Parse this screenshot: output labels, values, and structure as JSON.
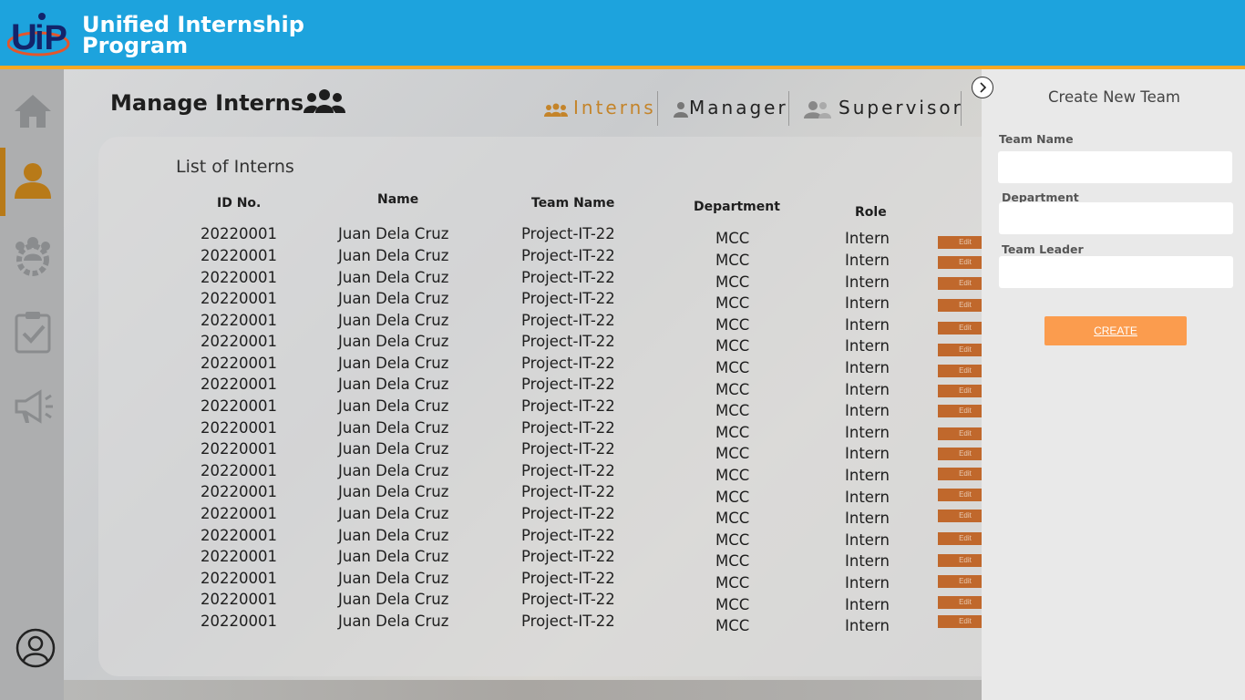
{
  "header": {
    "brand_line1": "Unified Internship",
    "brand_line2": "Program",
    "logo_text": "UiP"
  },
  "sidebar": {
    "items": [
      {
        "icon": "home-icon"
      },
      {
        "icon": "user-icon",
        "active": true
      },
      {
        "icon": "team-gear-icon"
      },
      {
        "icon": "clipboard-check-icon"
      },
      {
        "icon": "megaphone-icon"
      }
    ],
    "profile_icon": "profile-icon"
  },
  "page": {
    "title": "Manage Interns",
    "tabs": [
      {
        "label": "Interns",
        "active": true
      },
      {
        "label": "Manager"
      },
      {
        "label": "Supervisor"
      }
    ]
  },
  "list": {
    "title": "List of Interns",
    "columns": [
      "ID No.",
      "Name",
      "Team Name",
      "Department",
      "Role"
    ],
    "edit_label": "Edit",
    "rows": [
      {
        "id": "20220001",
        "name": "Juan Dela Cruz",
        "team": "Project-IT-22",
        "dept": "MCC",
        "role": "Intern"
      },
      {
        "id": "20220001",
        "name": "Juan Dela Cruz",
        "team": "Project-IT-22",
        "dept": "MCC",
        "role": "Intern"
      },
      {
        "id": "20220001",
        "name": "Juan Dela Cruz",
        "team": "Project-IT-22",
        "dept": "MCC",
        "role": "Intern"
      },
      {
        "id": "20220001",
        "name": "Juan Dela Cruz",
        "team": "Project-IT-22",
        "dept": "MCC",
        "role": "Intern"
      },
      {
        "id": "20220001",
        "name": "Juan Dela Cruz",
        "team": "Project-IT-22",
        "dept": "MCC",
        "role": "Intern"
      },
      {
        "id": "20220001",
        "name": "Juan Dela Cruz",
        "team": "Project-IT-22",
        "dept": "MCC",
        "role": "Intern"
      },
      {
        "id": "20220001",
        "name": "Juan Dela Cruz",
        "team": "Project-IT-22",
        "dept": "MCC",
        "role": "Intern"
      },
      {
        "id": "20220001",
        "name": "Juan Dela Cruz",
        "team": "Project-IT-22",
        "dept": "MCC",
        "role": "Intern"
      },
      {
        "id": "20220001",
        "name": "Juan Dela Cruz",
        "team": "Project-IT-22",
        "dept": "MCC",
        "role": "Intern"
      },
      {
        "id": "20220001",
        "name": "Juan Dela Cruz",
        "team": "Project-IT-22",
        "dept": "MCC",
        "role": "Intern"
      },
      {
        "id": "20220001",
        "name": "Juan Dela Cruz",
        "team": "Project-IT-22",
        "dept": "MCC",
        "role": "Intern"
      },
      {
        "id": "20220001",
        "name": "Juan Dela Cruz",
        "team": "Project-IT-22",
        "dept": "MCC",
        "role": "Intern"
      },
      {
        "id": "20220001",
        "name": "Juan Dela Cruz",
        "team": "Project-IT-22",
        "dept": "MCC",
        "role": "Intern"
      },
      {
        "id": "20220001",
        "name": "Juan Dela Cruz",
        "team": "Project-IT-22",
        "dept": "MCC",
        "role": "Intern"
      },
      {
        "id": "20220001",
        "name": "Juan Dela Cruz",
        "team": "Project-IT-22",
        "dept": "MCC",
        "role": "Intern"
      },
      {
        "id": "20220001",
        "name": "Juan Dela Cruz",
        "team": "Project-IT-22",
        "dept": "MCC",
        "role": "Intern"
      },
      {
        "id": "20220001",
        "name": "Juan Dela Cruz",
        "team": "Project-IT-22",
        "dept": "MCC",
        "role": "Intern"
      },
      {
        "id": "20220001",
        "name": "Juan Dela Cruz",
        "team": "Project-IT-22",
        "dept": "MCC",
        "role": "Intern"
      },
      {
        "id": "20220001",
        "name": "Juan Dela Cruz",
        "team": "Project-IT-22",
        "dept": "MCC",
        "role": "Intern"
      }
    ]
  },
  "panel": {
    "title": "Create New Team",
    "fields": [
      {
        "label": "Team Name",
        "value": "",
        "placeholder": ""
      },
      {
        "label": "Department",
        "value": "",
        "placeholder": ""
      },
      {
        "label": "Team Leader",
        "value": "",
        "placeholder": ""
      }
    ],
    "create_label": "CREATE"
  },
  "colors": {
    "header_blue": "#1da3dd",
    "accent_orange": "#f7a823",
    "edit_orange": "#c0682c",
    "create_orange": "#fb9c4e"
  }
}
